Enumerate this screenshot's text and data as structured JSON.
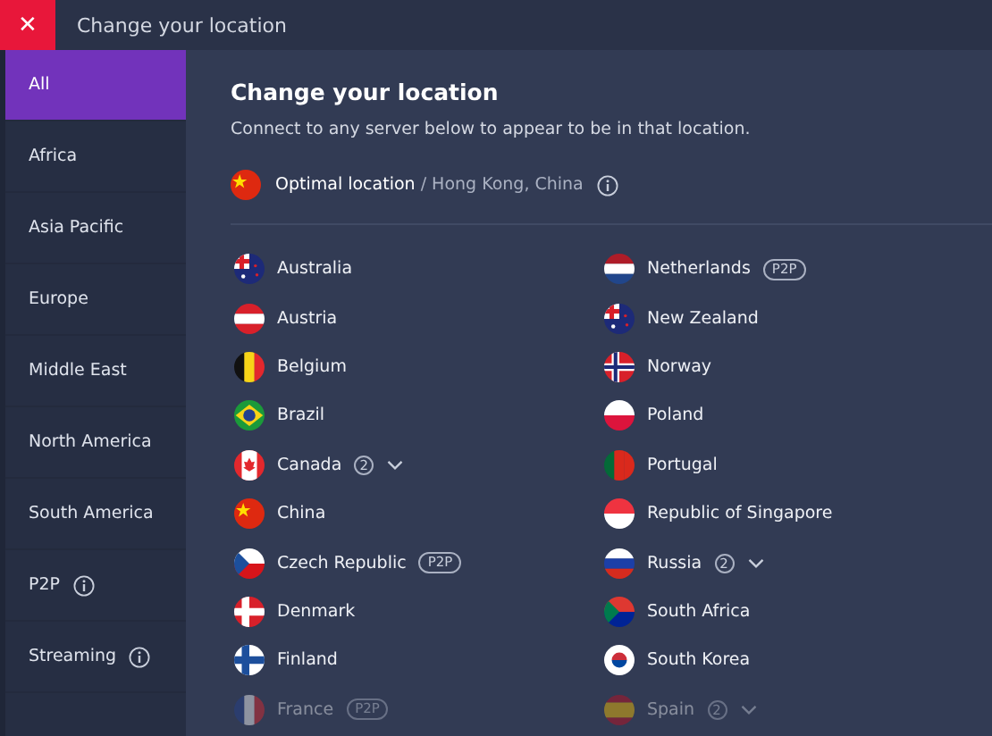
{
  "window": {
    "title": "Change your location",
    "close": "✕"
  },
  "sidebar": {
    "items": [
      {
        "label": "All",
        "selected": true,
        "info": false
      },
      {
        "label": "Africa",
        "selected": false,
        "info": false
      },
      {
        "label": "Asia Pacific",
        "selected": false,
        "info": false
      },
      {
        "label": "Europe",
        "selected": false,
        "info": false
      },
      {
        "label": "Middle East",
        "selected": false,
        "info": false
      },
      {
        "label": "North America",
        "selected": false,
        "info": false
      },
      {
        "label": "South America",
        "selected": false,
        "info": false
      },
      {
        "label": "P2P",
        "selected": false,
        "info": true
      },
      {
        "label": "Streaming",
        "selected": false,
        "info": true
      }
    ]
  },
  "heading": "Change your location",
  "subtitle": "Connect to any server below to appear to be in that location.",
  "optimal": {
    "label": "Optimal location",
    "detail": " / Hong Kong, China",
    "kind": "cn"
  },
  "columns": [
    {
      "items": [
        {
          "name": "Australia",
          "kind": "au",
          "dimmed": false
        },
        {
          "name": "Austria",
          "kind": "at",
          "dimmed": false
        },
        {
          "name": "Belgium",
          "kind": "be",
          "dimmed": false
        },
        {
          "name": "Brazil",
          "kind": "br",
          "dimmed": false
        },
        {
          "name": "Canada",
          "count": "2",
          "kind": "ca",
          "dimmed": false
        },
        {
          "name": "China",
          "kind": "cn",
          "dimmed": false
        },
        {
          "name": "Czech Republic",
          "tag": "P2P",
          "kind": "cz",
          "dimmed": false
        },
        {
          "name": "Denmark",
          "kind": "dk",
          "dimmed": false
        },
        {
          "name": "Finland",
          "kind": "fi",
          "dimmed": false
        },
        {
          "name": "France",
          "tag": "P2P",
          "kind": "fr",
          "dimmed": true
        }
      ]
    },
    {
      "items": [
        {
          "name": "Netherlands",
          "tag": "P2P",
          "kind": "nl",
          "dimmed": false
        },
        {
          "name": "New Zealand",
          "kind": "nz",
          "dimmed": false
        },
        {
          "name": "Norway",
          "kind": "no",
          "dimmed": false
        },
        {
          "name": "Poland",
          "kind": "pl",
          "dimmed": false
        },
        {
          "name": "Portugal",
          "kind": "pt",
          "dimmed": false
        },
        {
          "name": "Republic of Singapore",
          "kind": "sg",
          "dimmed": false
        },
        {
          "name": "Russia",
          "count": "2",
          "kind": "ru",
          "dimmed": false
        },
        {
          "name": "South Africa",
          "kind": "za",
          "dimmed": false
        },
        {
          "name": "South Korea",
          "kind": "kr",
          "dimmed": false
        },
        {
          "name": "Spain",
          "count": "2",
          "kind": "es",
          "dimmed": true
        }
      ]
    }
  ]
}
